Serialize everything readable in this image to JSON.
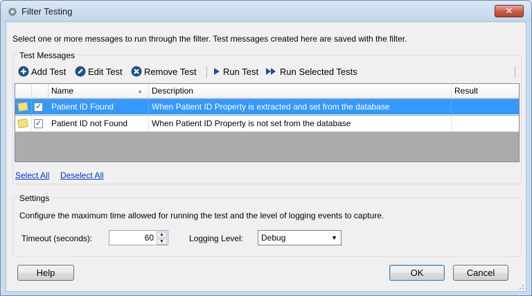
{
  "window": {
    "title": "Filter Testing",
    "close_glyph": "✕"
  },
  "intro": "Select one or more messages to run through the filter. Test messages created here are saved with the filter.",
  "test_messages": {
    "legend": "Test Messages",
    "toolbar": {
      "add_label": "Add Test",
      "edit_label": "Edit Test",
      "remove_label": "Remove Test",
      "run_label": "Run Test",
      "run_selected_label": "Run Selected Tests"
    },
    "columns": [
      "Name",
      "Description",
      "Result"
    ],
    "rows": [
      {
        "checked": true,
        "name": "Patient ID Found",
        "description": "When Patient ID Property is extracted and set from the database",
        "result": ""
      },
      {
        "checked": true,
        "name": "Patient ID not Found",
        "description": "When Patient ID Property is not set from the database",
        "result": ""
      }
    ],
    "select_all": "Select All",
    "deselect_all": "Deselect All"
  },
  "settings": {
    "legend": "Settings",
    "description": "Configure the maximum time allowed for running the test and the level of logging events to capture.",
    "timeout_label": "Timeout (seconds):",
    "timeout_value": "60",
    "logging_label": "Logging Level:",
    "logging_value": "Debug"
  },
  "footer": {
    "help_label": "Help",
    "ok_label": "OK",
    "cancel_label": "Cancel"
  },
  "icons": {
    "add": "plus-circle-icon",
    "edit": "pencil-circle-icon",
    "remove": "x-circle-icon",
    "run": "play-icon",
    "run_selected": "fast-forward-icon",
    "note": "sticky-note-icon"
  },
  "colors": {
    "selection": "#3399ff",
    "accent": "#1f4e8c",
    "link": "#0033cc"
  }
}
